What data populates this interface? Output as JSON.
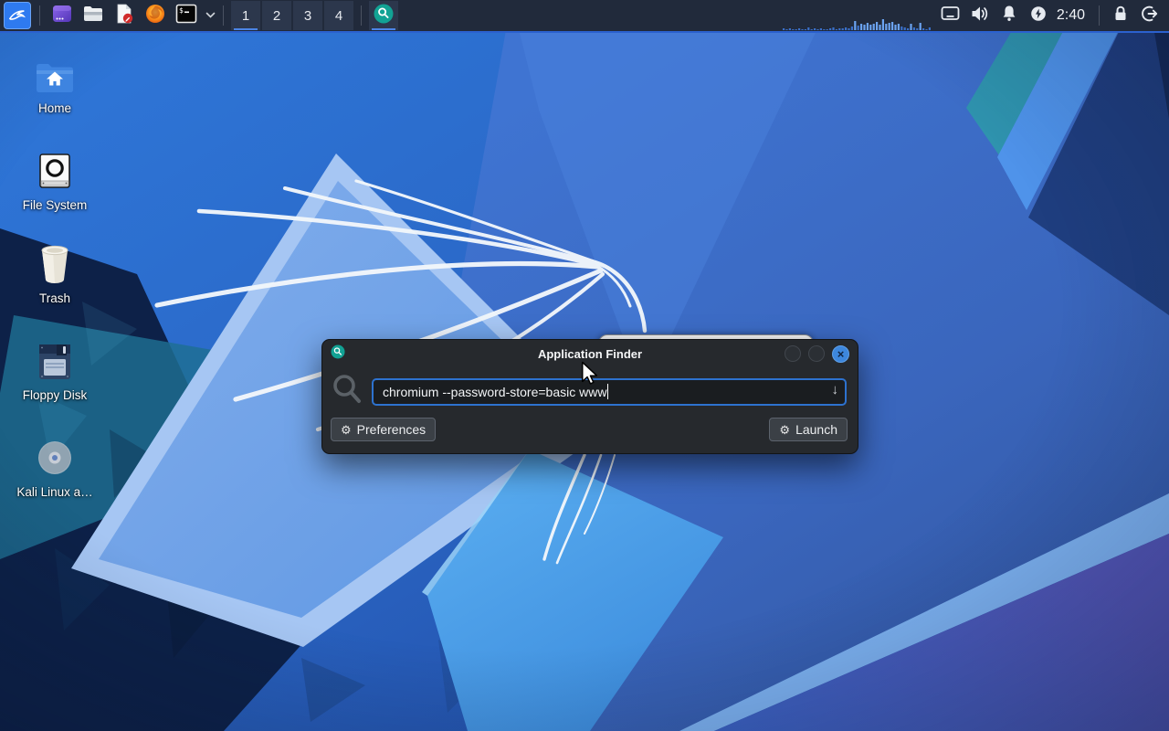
{
  "panel": {
    "launchers": [
      {
        "name": "kali-menu"
      },
      {
        "name": "window-app"
      },
      {
        "name": "file-manager"
      },
      {
        "name": "text-editor"
      },
      {
        "name": "firefox"
      },
      {
        "name": "terminal"
      }
    ],
    "workspaces": [
      "1",
      "2",
      "3",
      "4"
    ],
    "active_workspace": "1",
    "clock": "2:40",
    "cpu_graph_bars": [
      2,
      1,
      2,
      1,
      1,
      2,
      1,
      1,
      3,
      1,
      2,
      1,
      2,
      1,
      1,
      2,
      3,
      1,
      2,
      2,
      3,
      2,
      4,
      10,
      5,
      7,
      6,
      8,
      6,
      7,
      9,
      6,
      12,
      7,
      8,
      9,
      6,
      7,
      4,
      3,
      2,
      7,
      3,
      2,
      8,
      2,
      1,
      3
    ]
  },
  "desktop": {
    "icons": [
      {
        "label": "Home"
      },
      {
        "label": "File System"
      },
      {
        "label": "Trash"
      },
      {
        "label": "Floppy Disk"
      },
      {
        "label": "Kali Linux a…"
      }
    ]
  },
  "finder": {
    "title": "Application Finder",
    "query": "chromium --password-store=basic www",
    "preferences_label": "Preferences",
    "launch_label": "Launch",
    "close_glyph": "×",
    "drop_arrow_glyph": "↓",
    "gear_glyph": "⚙"
  },
  "colors": {
    "accent_blue": "#3584e4",
    "panel_bg": "#212a3b",
    "panel_border": "#2b61cf",
    "teal_badge": "#12a294",
    "dialog_bg": "#26292d",
    "input_border": "#2d72cf"
  }
}
